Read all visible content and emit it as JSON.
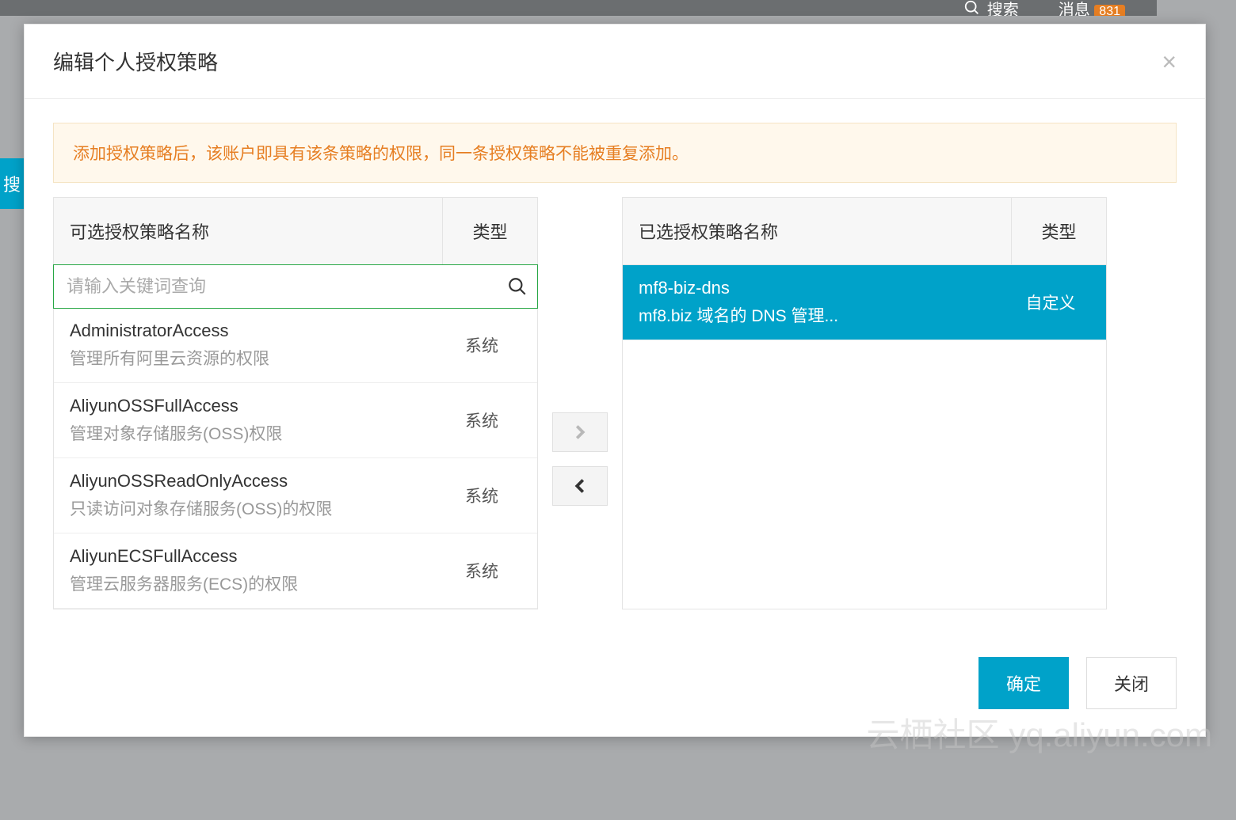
{
  "background": {
    "search_label": "搜索",
    "messages_label": "消息",
    "messages_count": "831",
    "side_tab": "搜"
  },
  "modal": {
    "title": "编辑个人授权策略",
    "close": "×",
    "alert": "添加授权策略后，该账户即具有该条策略的权限，同一条授权策略不能被重复添加。",
    "available": {
      "header_name": "可选授权策略名称",
      "header_type": "类型",
      "search_placeholder": "请输入关键词查询",
      "items": [
        {
          "name": "AdministratorAccess",
          "desc": "管理所有阿里云资源的权限",
          "type": "系统"
        },
        {
          "name": "AliyunOSSFullAccess",
          "desc": "管理对象存储服务(OSS)权限",
          "type": "系统"
        },
        {
          "name": "AliyunOSSReadOnlyAccess",
          "desc": "只读访问对象存储服务(OSS)的权限",
          "type": "系统"
        },
        {
          "name": "AliyunECSFullAccess",
          "desc": "管理云服务器服务(ECS)的权限",
          "type": "系统"
        }
      ]
    },
    "selected": {
      "header_name": "已选授权策略名称",
      "header_type": "类型",
      "items": [
        {
          "name": "mf8-biz-dns",
          "desc": "mf8.biz 域名的 DNS 管理...",
          "type": "自定义"
        }
      ]
    },
    "footer": {
      "confirm": "确定",
      "cancel": "关闭"
    }
  },
  "watermark": "云栖社区 yq.aliyun.com"
}
